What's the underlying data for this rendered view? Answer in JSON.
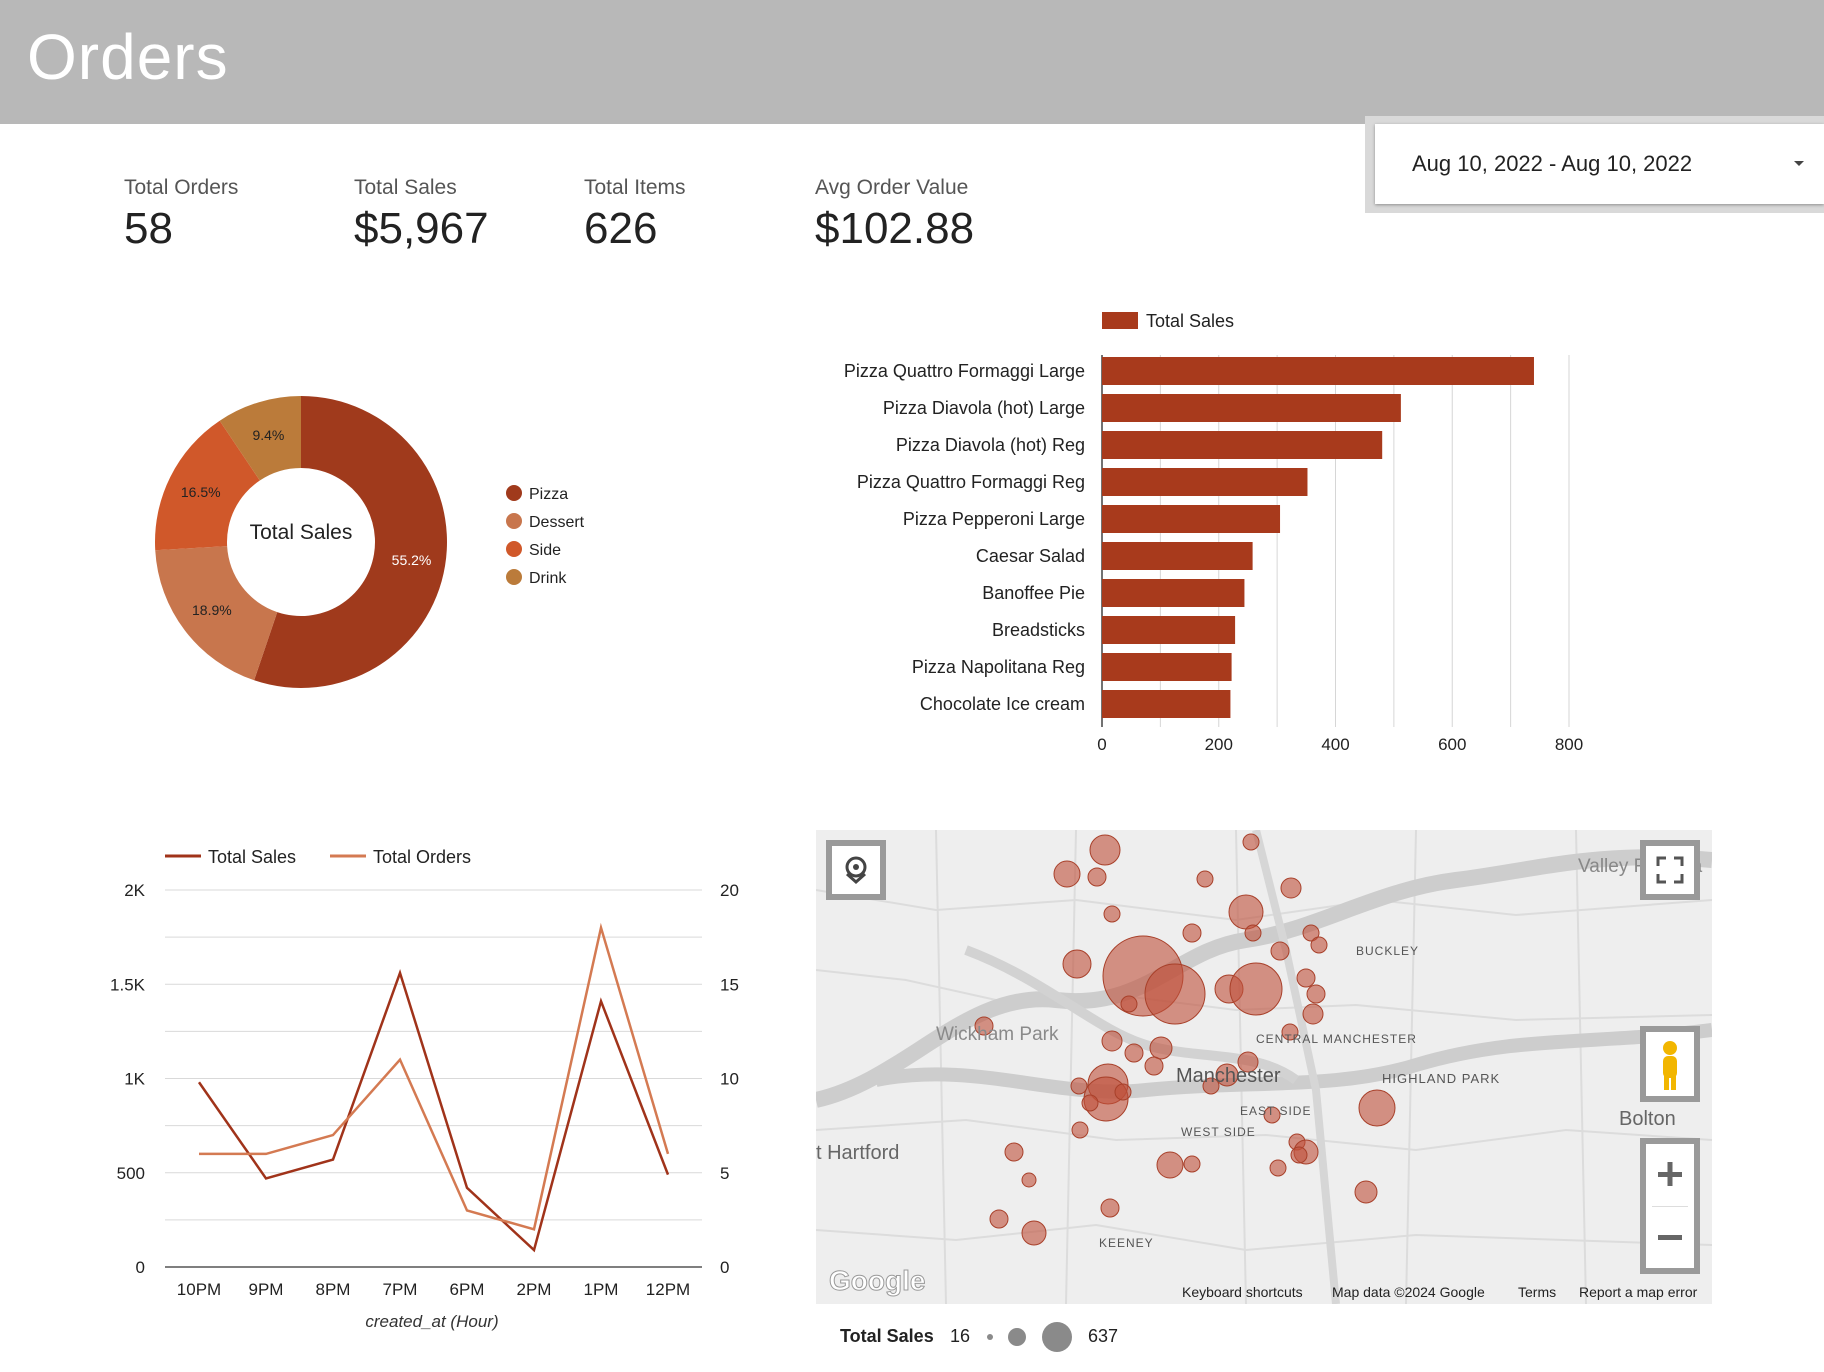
{
  "header": {
    "title": "Orders"
  },
  "date_range": {
    "label": "Aug 10, 2022 - Aug 10, 2022"
  },
  "kpis": [
    {
      "label": "Total Orders",
      "value": "58"
    },
    {
      "label": "Total Sales",
      "value": "$5,967"
    },
    {
      "label": "Total Items",
      "value": "626"
    },
    {
      "label": "Avg Order Value",
      "value": "$102.88"
    }
  ],
  "chart_data": [
    {
      "type": "pie",
      "center_label": "Total Sales",
      "legend_position": "right",
      "slices": [
        {
          "label": "Pizza",
          "value": 55.2,
          "display": "55.2%",
          "color": "#a03a1c"
        },
        {
          "label": "Dessert",
          "value": 18.9,
          "display": "18.9%",
          "color": "#c8764d"
        },
        {
          "label": "Side",
          "value": 16.5,
          "display": "16.5%",
          "color": "#d0582a"
        },
        {
          "label": "Drink",
          "value": 9.4,
          "display": "9.4%",
          "color": "#bb7b3a"
        }
      ]
    },
    {
      "type": "bar",
      "orientation": "horizontal",
      "series": [
        {
          "name": "Total Sales",
          "color": "#a83a1c",
          "values": [
            740,
            512,
            480,
            352,
            305,
            258,
            244,
            228,
            222,
            220
          ]
        }
      ],
      "categories": [
        "Pizza Quattro Formaggi Large",
        "Pizza Diavola (hot) Large",
        "Pizza Diavola (hot) Reg",
        "Pizza Quattro Formaggi Reg",
        "Pizza Pepperoni Large",
        "Caesar Salad",
        "Banoffee Pie",
        "Breadsticks",
        "Pizza Napolitana Reg",
        "Chocolate Ice cream"
      ],
      "xlim": [
        0,
        800
      ],
      "xticks": [
        "0",
        "200",
        "400",
        "600",
        "800"
      ],
      "legend_position": "top",
      "grid": true
    },
    {
      "type": "line",
      "x": [
        "10PM",
        "9PM",
        "8PM",
        "7PM",
        "6PM",
        "2PM",
        "1PM",
        "12PM"
      ],
      "xlabel": "created_at (Hour)",
      "series": [
        {
          "name": "Total Sales",
          "axis": "left",
          "color": "#a0331a",
          "values": [
            980,
            470,
            570,
            1560,
            420,
            90,
            1410,
            490
          ]
        },
        {
          "name": "Total Orders",
          "axis": "right",
          "color": "#d47a52",
          "values": [
            6,
            6,
            7,
            11,
            3,
            2,
            18,
            6
          ]
        }
      ],
      "ylim_left": [
        0,
        2000
      ],
      "ylim_right": [
        0,
        20
      ],
      "yticks_left": [
        "0",
        "500",
        "1K",
        "1.5K",
        "2K"
      ],
      "yticks_right": [
        "0",
        "5",
        "10",
        "15",
        "20"
      ],
      "legend_position": "top",
      "grid": true
    }
  ],
  "map": {
    "place_labels": [
      "Valley Falls Pa",
      "BUCKLEY",
      "Wickham Park",
      "CENTRAL MANCHESTER",
      "Manchester",
      "HIGHLAND PARK",
      "EAST SIDE",
      "WEST SIDE",
      "t Hartford",
      "Bolton",
      "KEENEY"
    ],
    "footer": {
      "logo": "Google",
      "shortcuts": "Keyboard shortcuts",
      "attribution": "Map data ©2024 Google",
      "terms": "Terms",
      "report": "Report a map error"
    },
    "legend": {
      "title": "Total Sales",
      "min": "16",
      "max": "637"
    },
    "bubble_color": "#c0503a",
    "bubbles": [
      {
        "x": 283,
        "y": 29,
        "r": 13
      },
      {
        "x": 382,
        "y": 12,
        "r": 8
      },
      {
        "x": 294,
        "y": 49,
        "r": 7
      },
      {
        "x": 256,
        "y": 113,
        "r": 9
      },
      {
        "x": 345,
        "y": 97,
        "r": 17
      },
      {
        "x": 334,
        "y": 160,
        "r": 35
      },
      {
        "x": 372,
        "y": 170,
        "r": 14
      },
      {
        "x": 304,
        "y": 135,
        "r": 11
      },
      {
        "x": 305,
        "y": 156,
        "r": 8
      },
      {
        "x": 338,
        "y": 191,
        "r": 12
      },
      {
        "x": 351,
        "y": 188,
        "r": 12
      },
      {
        "x": 367,
        "y": 187,
        "r": 8
      },
      {
        "x": 328,
        "y": 221,
        "r": 9
      },
      {
        "x": 364,
        "y": 238,
        "r": 10
      },
      {
        "x": 374,
        "y": 220,
        "r": 12
      },
      {
        "x": 400,
        "y": 230,
        "r": 12
      },
      {
        "x": 313,
        "y": 244,
        "r": 10
      },
      {
        "x": 345,
        "y": 252,
        "r": 9
      },
      {
        "x": 400,
        "y": 252,
        "r": 11
      },
      {
        "x": 331,
        "y": 288,
        "r": 25
      },
      {
        "x": 371,
        "y": 267,
        "r": 9
      },
      {
        "x": 355,
        "y": 294,
        "r": 8
      },
      {
        "x": 382,
        "y": 302,
        "r": 9
      },
      {
        "x": 400,
        "y": 301,
        "r": 11
      },
      {
        "x": 281,
        "y": 307,
        "r": 8
      },
      {
        "x": 299,
        "y": 330,
        "r": 10
      },
      {
        "x": 313,
        "y": 352,
        "r": 9
      },
      {
        "x": 372,
        "y": 350,
        "r": 10
      },
      {
        "x": 349,
        "y": 381,
        "r": 12
      },
      {
        "x": 248,
        "y": 369,
        "r": 11
      },
      {
        "x": 257,
        "y": 392,
        "r": 8
      },
      {
        "x": 297,
        "y": 400,
        "r": 11
      },
      {
        "x": 265,
        "y": 425,
        "r": 8
      },
      {
        "x": 283,
        "y": 445,
        "r": 9
      },
      {
        "x": 228,
        "y": 455,
        "r": 12
      }
    ]
  },
  "map_bubbles": [
    {
      "x": 289,
      "y": 20,
      "r": 15
    },
    {
      "x": 435,
      "y": 12,
      "r": 8
    },
    {
      "x": 251,
      "y": 44,
      "r": 13
    },
    {
      "x": 281,
      "y": 47,
      "r": 9
    },
    {
      "x": 389,
      "y": 49,
      "r": 8
    },
    {
      "x": 475,
      "y": 58,
      "r": 10
    },
    {
      "x": 430,
      "y": 82,
      "r": 17
    },
    {
      "x": 296,
      "y": 84,
      "r": 8
    },
    {
      "x": 437,
      "y": 103,
      "r": 8
    },
    {
      "x": 376,
      "y": 103,
      "r": 9
    },
    {
      "x": 495,
      "y": 103,
      "r": 8
    },
    {
      "x": 503,
      "y": 115,
      "r": 8
    },
    {
      "x": 464,
      "y": 121,
      "r": 9
    },
    {
      "x": 261,
      "y": 134,
      "r": 14
    },
    {
      "x": 327,
      "y": 146,
      "r": 40
    },
    {
      "x": 359,
      "y": 164,
      "r": 30
    },
    {
      "x": 413,
      "y": 159,
      "r": 14
    },
    {
      "x": 440,
      "y": 159,
      "r": 26
    },
    {
      "x": 490,
      "y": 148,
      "r": 9
    },
    {
      "x": 500,
      "y": 164,
      "r": 9
    },
    {
      "x": 313,
      "y": 174,
      "r": 8
    },
    {
      "x": 497,
      "y": 184,
      "r": 10
    },
    {
      "x": 168,
      "y": 196,
      "r": 9
    },
    {
      "x": 474,
      "y": 202,
      "r": 8
    },
    {
      "x": 296,
      "y": 211,
      "r": 10
    },
    {
      "x": 318,
      "y": 223,
      "r": 9
    },
    {
      "x": 345,
      "y": 218,
      "r": 11
    },
    {
      "x": 432,
      "y": 232,
      "r": 10
    },
    {
      "x": 338,
      "y": 236,
      "r": 9
    },
    {
      "x": 411,
      "y": 245,
      "r": 11
    },
    {
      "x": 395,
      "y": 256,
      "r": 8
    },
    {
      "x": 292,
      "y": 254,
      "r": 20
    },
    {
      "x": 263,
      "y": 256,
      "r": 8
    },
    {
      "x": 290,
      "y": 269,
      "r": 22
    },
    {
      "x": 274,
      "y": 273,
      "r": 8
    },
    {
      "x": 307,
      "y": 262,
      "r": 8
    },
    {
      "x": 561,
      "y": 278,
      "r": 18
    },
    {
      "x": 456,
      "y": 285,
      "r": 8
    },
    {
      "x": 264,
      "y": 300,
      "r": 8
    },
    {
      "x": 481,
      "y": 312,
      "r": 8
    },
    {
      "x": 490,
      "y": 322,
      "r": 12
    },
    {
      "x": 483,
      "y": 325,
      "r": 8
    },
    {
      "x": 198,
      "y": 322,
      "r": 9
    },
    {
      "x": 354,
      "y": 335,
      "r": 13
    },
    {
      "x": 376,
      "y": 334,
      "r": 8
    },
    {
      "x": 462,
      "y": 338,
      "r": 8
    },
    {
      "x": 213,
      "y": 350,
      "r": 7
    },
    {
      "x": 550,
      "y": 362,
      "r": 11
    },
    {
      "x": 294,
      "y": 378,
      "r": 9
    },
    {
      "x": 183,
      "y": 389,
      "r": 9
    },
    {
      "x": 218,
      "y": 403,
      "r": 12
    }
  ]
}
